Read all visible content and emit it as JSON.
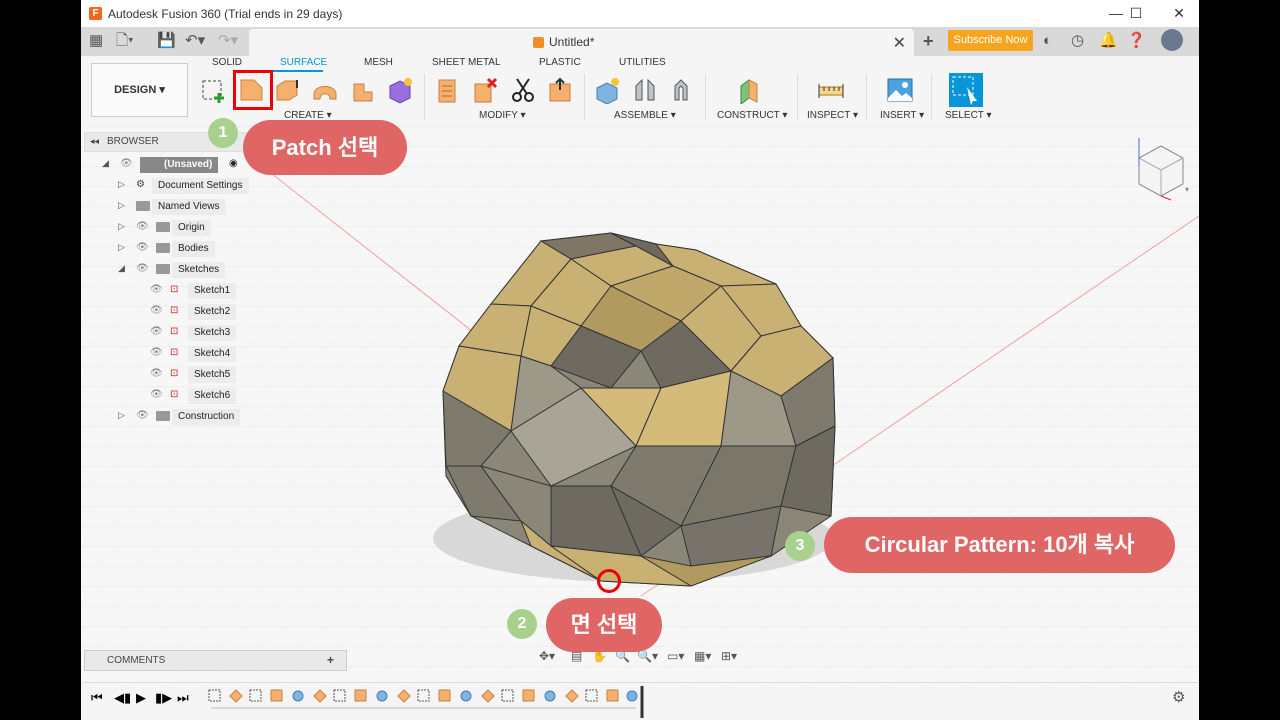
{
  "window": {
    "title": "Autodesk Fusion 360 (Trial ends in 29 days)",
    "minimize": "—",
    "maximize": "☐",
    "close": "✕"
  },
  "tabbar": {
    "document_name": "Untitled*",
    "close_tab": "✕",
    "new_tab": "+",
    "subscribe_label": "Subscribe Now"
  },
  "toolbar": {
    "design_label": "DESIGN ▾",
    "tabs": [
      "SOLID",
      "SURFACE",
      "MESH",
      "SHEET METAL",
      "PLASTIC",
      "UTILITIES"
    ],
    "active_tab": "SURFACE",
    "groups": [
      "CREATE ▾",
      "MODIFY ▾",
      "ASSEMBLE ▾",
      "CONSTRUCT ▾",
      "INSPECT ▾",
      "INSERT ▾",
      "SELECT ▾"
    ]
  },
  "browser": {
    "title": "BROWSER",
    "root": "(Unsaved)",
    "items": [
      {
        "label": "Document Settings"
      },
      {
        "label": "Named Views"
      },
      {
        "label": "Origin"
      },
      {
        "label": "Bodies"
      },
      {
        "label": "Sketches"
      },
      {
        "label": "Sketch1"
      },
      {
        "label": "Sketch2"
      },
      {
        "label": "Sketch3"
      },
      {
        "label": "Sketch4"
      },
      {
        "label": "Sketch5"
      },
      {
        "label": "Sketch6"
      },
      {
        "label": "Construction"
      }
    ]
  },
  "comments": {
    "label": "COMMENTS",
    "add": "+"
  },
  "callouts": [
    {
      "number": "1",
      "text": "Patch 선택"
    },
    {
      "number": "2",
      "text": "면 선택"
    },
    {
      "number": "3",
      "text": "Circular Pattern: 10개 복사"
    }
  ],
  "colors": {
    "accent": "#0696d7",
    "subscribe": "#f7a51e",
    "callout_pill": "#e06666",
    "callout_badge": "#a9d18e",
    "highlight": "#ee0000",
    "face_tan": "#c8b173",
    "face_gray": "#8a8678"
  }
}
